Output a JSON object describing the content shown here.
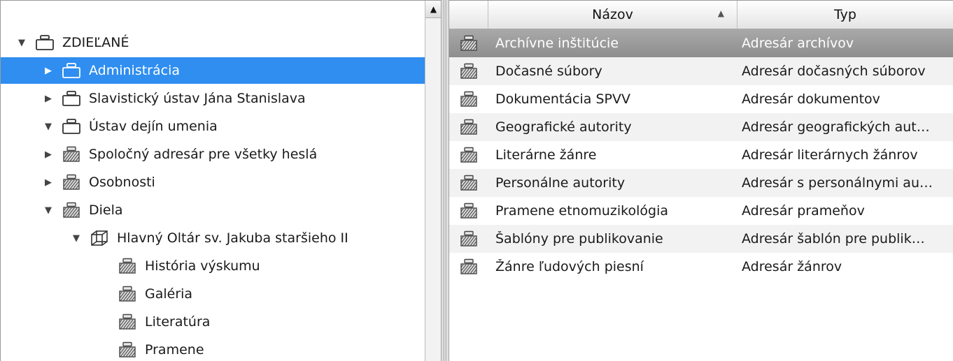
{
  "tree": {
    "scroll_up_glyph": "▲",
    "items": [
      {
        "label": "ZDIEĽANÉ",
        "toggle": "▼",
        "icon": "shared-folder-icon",
        "level": 0,
        "selected": false
      },
      {
        "label": "Administrácia",
        "toggle": "▶",
        "icon": "shared-folder-icon",
        "level": 1,
        "selected": true
      },
      {
        "label": "Slavistický ústav Jána Stanislava",
        "toggle": "▶",
        "icon": "shared-folder-icon",
        "level": 1,
        "selected": false
      },
      {
        "label": "Ústav dejín umenia",
        "toggle": "▼",
        "icon": "shared-folder-icon",
        "level": 1,
        "selected": false
      },
      {
        "label": "Spoločný adresár pre všetky heslá",
        "toggle": "▶",
        "icon": "archive-drawer-icon",
        "level": 2,
        "selected": false
      },
      {
        "label": "Osobnosti",
        "toggle": "▶",
        "icon": "archive-drawer-icon",
        "level": 2,
        "selected": false
      },
      {
        "label": "Diela",
        "toggle": "▼",
        "icon": "archive-drawer-icon",
        "level": 2,
        "selected": false
      },
      {
        "label": "Hlavný Oltár sv. Jakuba staršieho II",
        "toggle": "▼",
        "icon": "cube-icon",
        "level": 3,
        "selected": false
      },
      {
        "label": "História výskumu",
        "toggle": "",
        "icon": "archive-drawer-icon",
        "level": 4,
        "selected": false
      },
      {
        "label": "Galéria",
        "toggle": "",
        "icon": "archive-drawer-icon",
        "level": 4,
        "selected": false
      },
      {
        "label": "Literatúra",
        "toggle": "",
        "icon": "archive-drawer-icon",
        "level": 4,
        "selected": false
      },
      {
        "label": "Pramene",
        "toggle": "",
        "icon": "archive-drawer-icon",
        "level": 4,
        "selected": false
      }
    ]
  },
  "list": {
    "columns": {
      "name": "Názov",
      "type": "Typ"
    },
    "sort_glyph": "▲",
    "rows": [
      {
        "name": "Archívne inštitúcie",
        "type": "Adresár archívov",
        "selected": true
      },
      {
        "name": "Dočasné súbory",
        "type": "Adresár dočasných súborov",
        "selected": false
      },
      {
        "name": "Dokumentácia SPVV",
        "type": "Adresár dokumentov",
        "selected": false
      },
      {
        "name": "Geografické autority",
        "type": "Adresár geografických aut…",
        "selected": false
      },
      {
        "name": "Literárne žánre",
        "type": "Adresár literárnych žánrov",
        "selected": false
      },
      {
        "name": "Personálne autority",
        "type": "Adresár s personálnymi au…",
        "selected": false
      },
      {
        "name": "Pramene etnomuzikológia",
        "type": "Adresár prameňov",
        "selected": false
      },
      {
        "name": "Šablóny pre publikovanie",
        "type": "Adresár šablón pre publik…",
        "selected": false
      },
      {
        "name": "Žánre ľudových piesní",
        "type": "Adresár žánrov",
        "selected": false
      }
    ]
  },
  "colors": {
    "selection_blue": "#2f8ef0",
    "selection_gray": "#9a9a9a"
  }
}
